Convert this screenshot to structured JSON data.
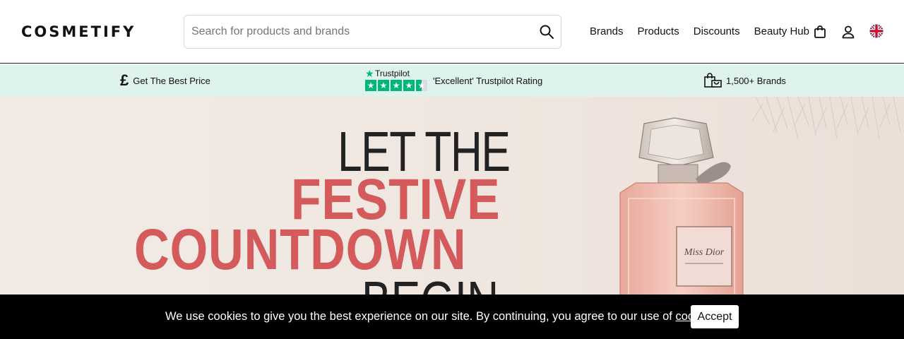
{
  "header": {
    "logo": "COSMETIFY",
    "search": {
      "placeholder": "Search for products and brands",
      "value": ""
    },
    "nav": [
      "Brands",
      "Products",
      "Discounts",
      "Beauty Hub"
    ],
    "icons": [
      "search-icon",
      "shopping-bag-icon",
      "user-icon",
      "uk-flag-icon"
    ]
  },
  "usp_bar": {
    "price_symbol": "£",
    "price_text": "Get The Best Price",
    "trustpilot_name": "Trustpilot",
    "trustpilot_text": "'Excellent' Trustpilot Rating",
    "brands_text": "1,500+ Brands",
    "background": "#dff3ee",
    "trustpilot_color": "#00b67a"
  },
  "hero": {
    "line1": "LET THE",
    "line2": "FESTIVE",
    "line3": "COUNTDOWN",
    "line4": "BEGIN",
    "accent": "#d45a5b",
    "bottle_label": "Miss Dior"
  },
  "cookie_bar": {
    "text_before": "We use cookies to give you the best experience on our site. By continuing, you agree to our use of ",
    "link": "cookies",
    "text_after": ".",
    "button": "Accept"
  }
}
